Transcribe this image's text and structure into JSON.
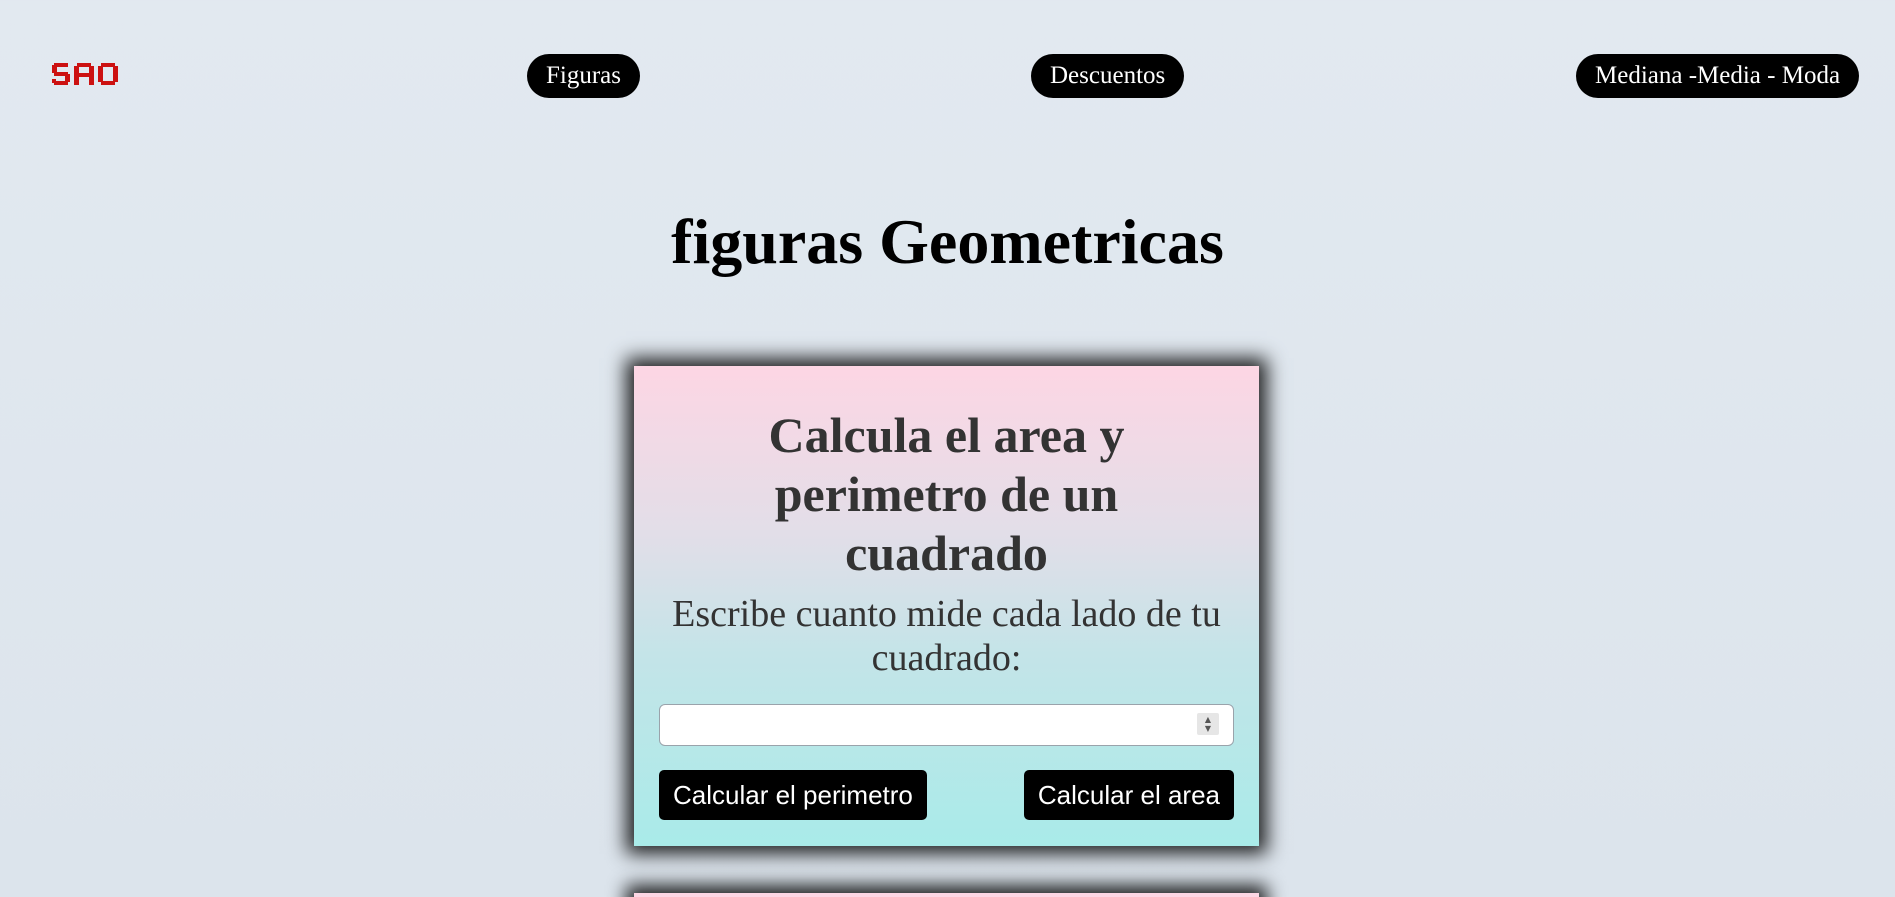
{
  "logo": {
    "text": "SAO",
    "color": "#cc1111"
  },
  "nav": {
    "figuras": "Figuras",
    "descuentos": "Descuentos",
    "mediana_media_moda": "Mediana -Media - Moda"
  },
  "page_title": "figuras Geometricas",
  "card": {
    "title_lines": [
      "Calcula el area y",
      "perimetro de un",
      "cuadrado"
    ],
    "subtitle": "Escribe cuanto mide cada lado de tu cuadrado:",
    "input": {
      "value": "",
      "placeholder": ""
    },
    "buttons": {
      "perimetro": "Calcular el perimetro",
      "area": "Calcular el area"
    }
  },
  "colors": {
    "button_bg": "#000000",
    "card_gradient_top": "#fdd6e4",
    "card_gradient_bottom": "#a9ebe9"
  }
}
